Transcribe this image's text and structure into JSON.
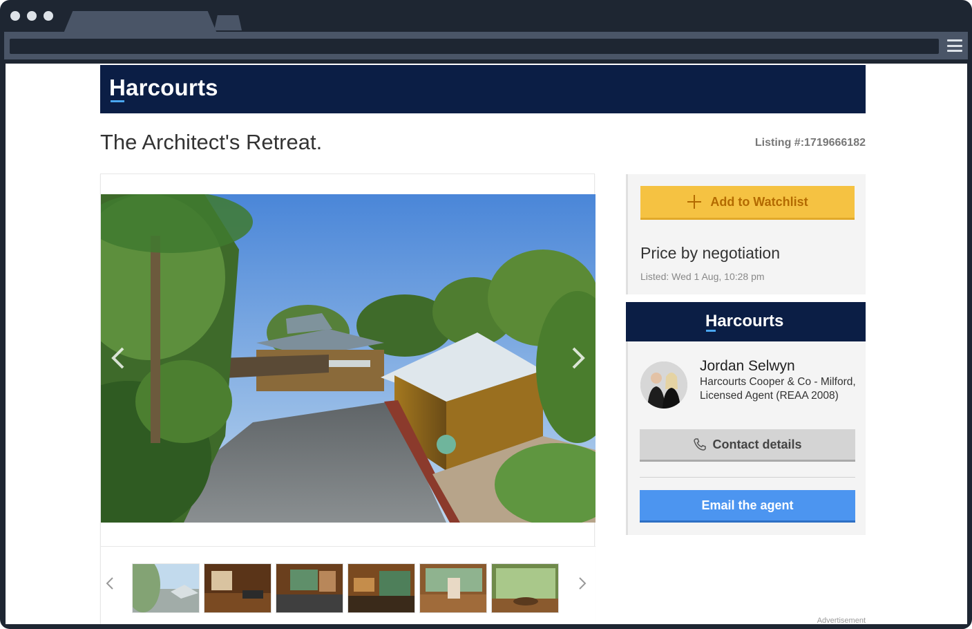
{
  "site": {
    "brand": "Harcourts"
  },
  "listing": {
    "title": "The Architect's Retreat.",
    "number": "Listing #:1719666182",
    "price": "Price by negotiation",
    "listed": "Listed: Wed 1 Aug, 10:28 pm"
  },
  "actions": {
    "watchlist_label": "Add to Watchlist",
    "contact_label": "Contact details",
    "email_label": "Email the agent"
  },
  "agent": {
    "brand": "Harcourts",
    "name": "Jordan Selwyn",
    "org": "Harcourts Cooper & Co - Milford, Licensed Agent (REAA 2008)"
  },
  "ad": {
    "label": "Advertisement"
  },
  "gallery": {
    "thumbnail_count": 6
  },
  "colors": {
    "brand_navy": "#0b1e45",
    "watchlist_yellow": "#f5c242",
    "email_blue": "#4c95f0"
  },
  "icons": [
    "browser-menu-icon",
    "plus-icon",
    "phone-icon",
    "chevron-left-icon",
    "chevron-right-icon"
  ]
}
